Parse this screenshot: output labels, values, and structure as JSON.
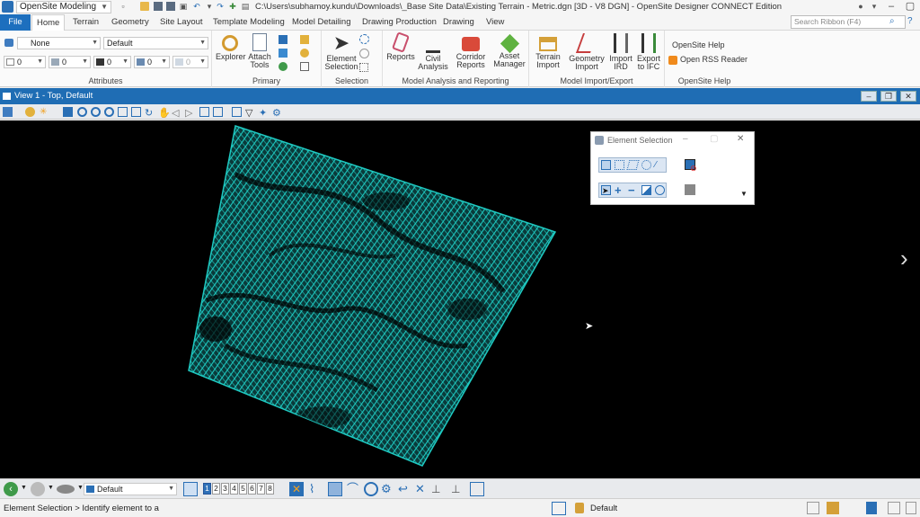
{
  "workflow": "OpenSite Modeling",
  "window_title": "C:\\Users\\subhamoy.kundu\\Downloads\\_Base Site Data\\Existing Terrain - Metric.dgn [3D - V8 DGN] - OpenSite Designer CONNECT Edition",
  "tabs": [
    "File",
    "Home",
    "Terrain",
    "Geometry",
    "Site Layout",
    "Template Modeling",
    "Model Detailing",
    "Drawing Production",
    "Drawing",
    "View"
  ],
  "active_tab": "Home",
  "search_ribbon": {
    "placeholder": "Search Ribbon (F4)"
  },
  "attributes": {
    "label": "Attributes",
    "level": "None",
    "style": "Default",
    "color": "0",
    "weight": "0",
    "line_style": "0",
    "transparency": "0",
    "priority": "0"
  },
  "primary": {
    "label": "Primary",
    "explorer": "Explorer",
    "attach_tools": "Attach Tools"
  },
  "selection": {
    "label": "Selection",
    "element_selection": "Element Selection"
  },
  "analysis": {
    "label": "Model Analysis and Reporting",
    "reports": "Reports",
    "civil_analysis": "Civil Analysis",
    "corridor_reports": "Corridor Reports",
    "asset_manager": "Asset Manager"
  },
  "import_export": {
    "label": "Model Import/Export",
    "terrain_import": "Terrain Import",
    "geometry_import": "Geometry Import",
    "import_ird": "Import IRD",
    "export_ifc": "Export to IFC"
  },
  "help": {
    "label": "OpenSite Help",
    "opensite_help": "OpenSite Help",
    "rss": "Open RSS Reader"
  },
  "view": {
    "title": "View 1 - Top, Default"
  },
  "element_selection_dialog": {
    "title": "Element Selection"
  },
  "bottom": {
    "model": "Default",
    "view_numbers": [
      "1",
      "2",
      "3",
      "4",
      "5",
      "6",
      "7",
      "8"
    ]
  },
  "status": {
    "prompt": "Element Selection > Identify element to a",
    "level": "Default"
  },
  "colors": {
    "accent": "#1d6fbe",
    "view_header": "#1f6db4",
    "terrain_mesh": "#1ec8c0"
  }
}
